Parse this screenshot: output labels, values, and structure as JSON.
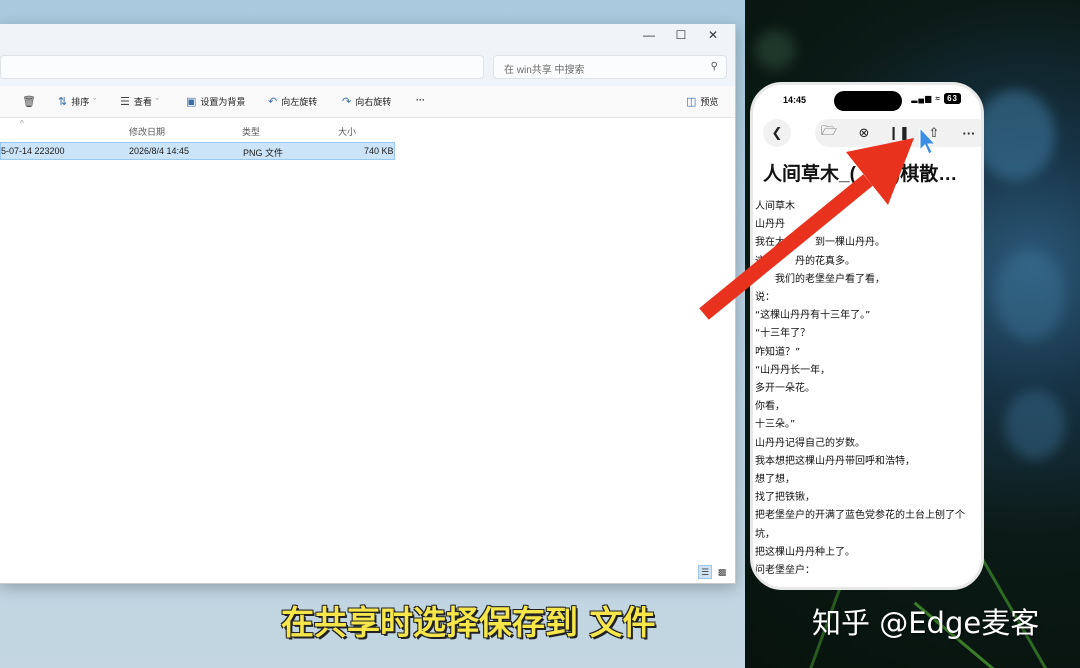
{
  "window": {
    "controls": [
      "—",
      "☐",
      "✕"
    ],
    "search_placeholder": "在 win共享 中搜索",
    "toolbar": {
      "sort": "排序",
      "view": "查看",
      "set_background": "设置为背景",
      "rotate_left": "向左旋转",
      "rotate_right": "向右旋转",
      "more": "···",
      "preview": "预览"
    },
    "columns": {
      "date_modified": "修改日期",
      "type": "类型",
      "size": "大小"
    },
    "file": {
      "name_partial": "5-07-14 223200",
      "date_modified": "2026/8/4 14:45",
      "type": "PNG 文件",
      "size": "740 KB"
    }
  },
  "phone": {
    "time": "14:45",
    "battery": "63",
    "doc_title": "人间草木_(　　)棋散…",
    "lines": [
      "人间草木",
      "山丹丹",
      "我在大青　　到一棵山丹丹。",
      "这棵　　丹的花真多。",
      "　　我们的老堡垒户看了看，",
      "说：",
      "“这棵山丹丹有十三年了。”",
      "“十三年了？",
      "咋知道？”",
      "“山丹丹长一年，",
      "多开一朵花。",
      "你看，",
      "十三朵。”",
      "山丹丹记得自己的岁数。",
      "我本想把这棵山丹丹带回呼和浩特，",
      "想了想，",
      "找了把铁锹，",
      "把老堡垒户的开满了蓝色党参花的土台上刨了个",
      "坑，",
      "把这棵山丹丹种上了。",
      "问老堡垒户："
    ]
  },
  "caption": "在共享时选择保存到 文件",
  "watermark": "知乎 @Edge麦客",
  "colors": {
    "arrow": "#e8321e",
    "caption": "#f6e64a",
    "selection": "#cce4f7"
  }
}
